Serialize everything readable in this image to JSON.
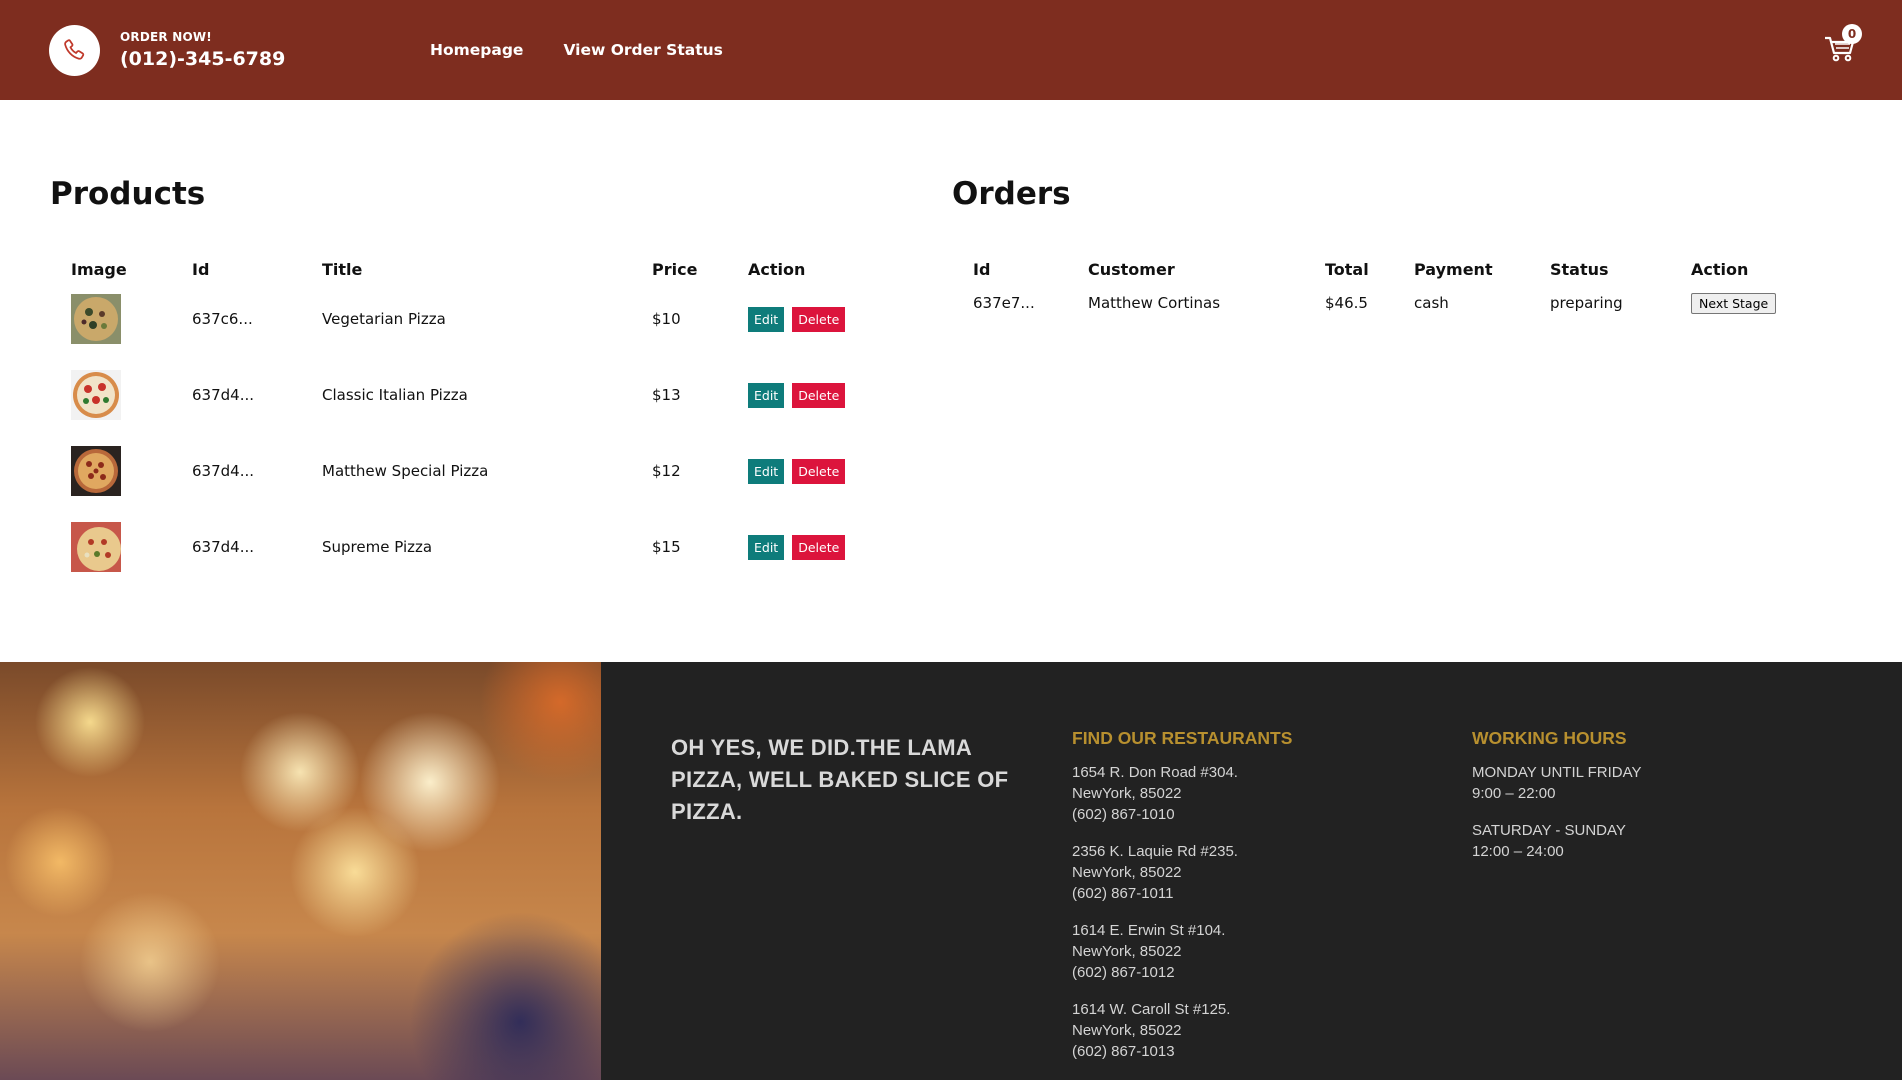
{
  "navbar": {
    "order_label": "ORDER NOW!",
    "phone": "(012)-345-6789",
    "links": [
      "Homepage",
      "View Order Status"
    ],
    "cart_count": "0",
    "bg_color": "#7e2d1f"
  },
  "products": {
    "title": "Products",
    "headers": [
      "Image",
      "Id",
      "Title",
      "Price",
      "Action"
    ],
    "rows": [
      {
        "id": "637c6...",
        "title": "Vegetarian Pizza",
        "price": "$10"
      },
      {
        "id": "637d4...",
        "title": "Classic Italian Pizza",
        "price": "$13"
      },
      {
        "id": "637d4...",
        "title": "Matthew Special Pizza",
        "price": "$12"
      },
      {
        "id": "637d4...",
        "title": "Supreme Pizza",
        "price": "$15"
      }
    ],
    "edit_label": "Edit",
    "delete_label": "Delete"
  },
  "orders": {
    "title": "Orders",
    "headers": [
      "Id",
      "Customer",
      "Total",
      "Payment",
      "Status",
      "Action"
    ],
    "rows": [
      {
        "id": "637e7...",
        "customer": "Matthew Cortinas",
        "total": "$46.5",
        "payment": "cash",
        "status": "preparing",
        "action": "Next Stage"
      }
    ]
  },
  "footer": {
    "motto": "OH YES, WE DID.THE LAMA PIZZA, WELL BAKED SLICE OF PIZZA.",
    "restaurants_title": "FIND OUR RESTAURANTS",
    "restaurants": [
      {
        "street": "1654 R. Don Road #304.",
        "city": "NewYork, 85022",
        "phone": "(602) 867-1010"
      },
      {
        "street": "2356 K. Laquie Rd #235.",
        "city": "NewYork, 85022",
        "phone": "(602) 867-1011"
      },
      {
        "street": "1614 E. Erwin St #104.",
        "city": "NewYork, 85022",
        "phone": "(602) 867-1012"
      },
      {
        "street": "1614 W. Caroll St #125.",
        "city": "NewYork, 85022",
        "phone": "(602) 867-1013"
      }
    ],
    "hours_title": "WORKING HOURS",
    "hours": [
      {
        "days": "MONDAY UNTIL FRIDAY",
        "time": "9:00 – 22:00"
      },
      {
        "days": "SATURDAY - SUNDAY",
        "time": "12:00 – 24:00"
      }
    ]
  }
}
